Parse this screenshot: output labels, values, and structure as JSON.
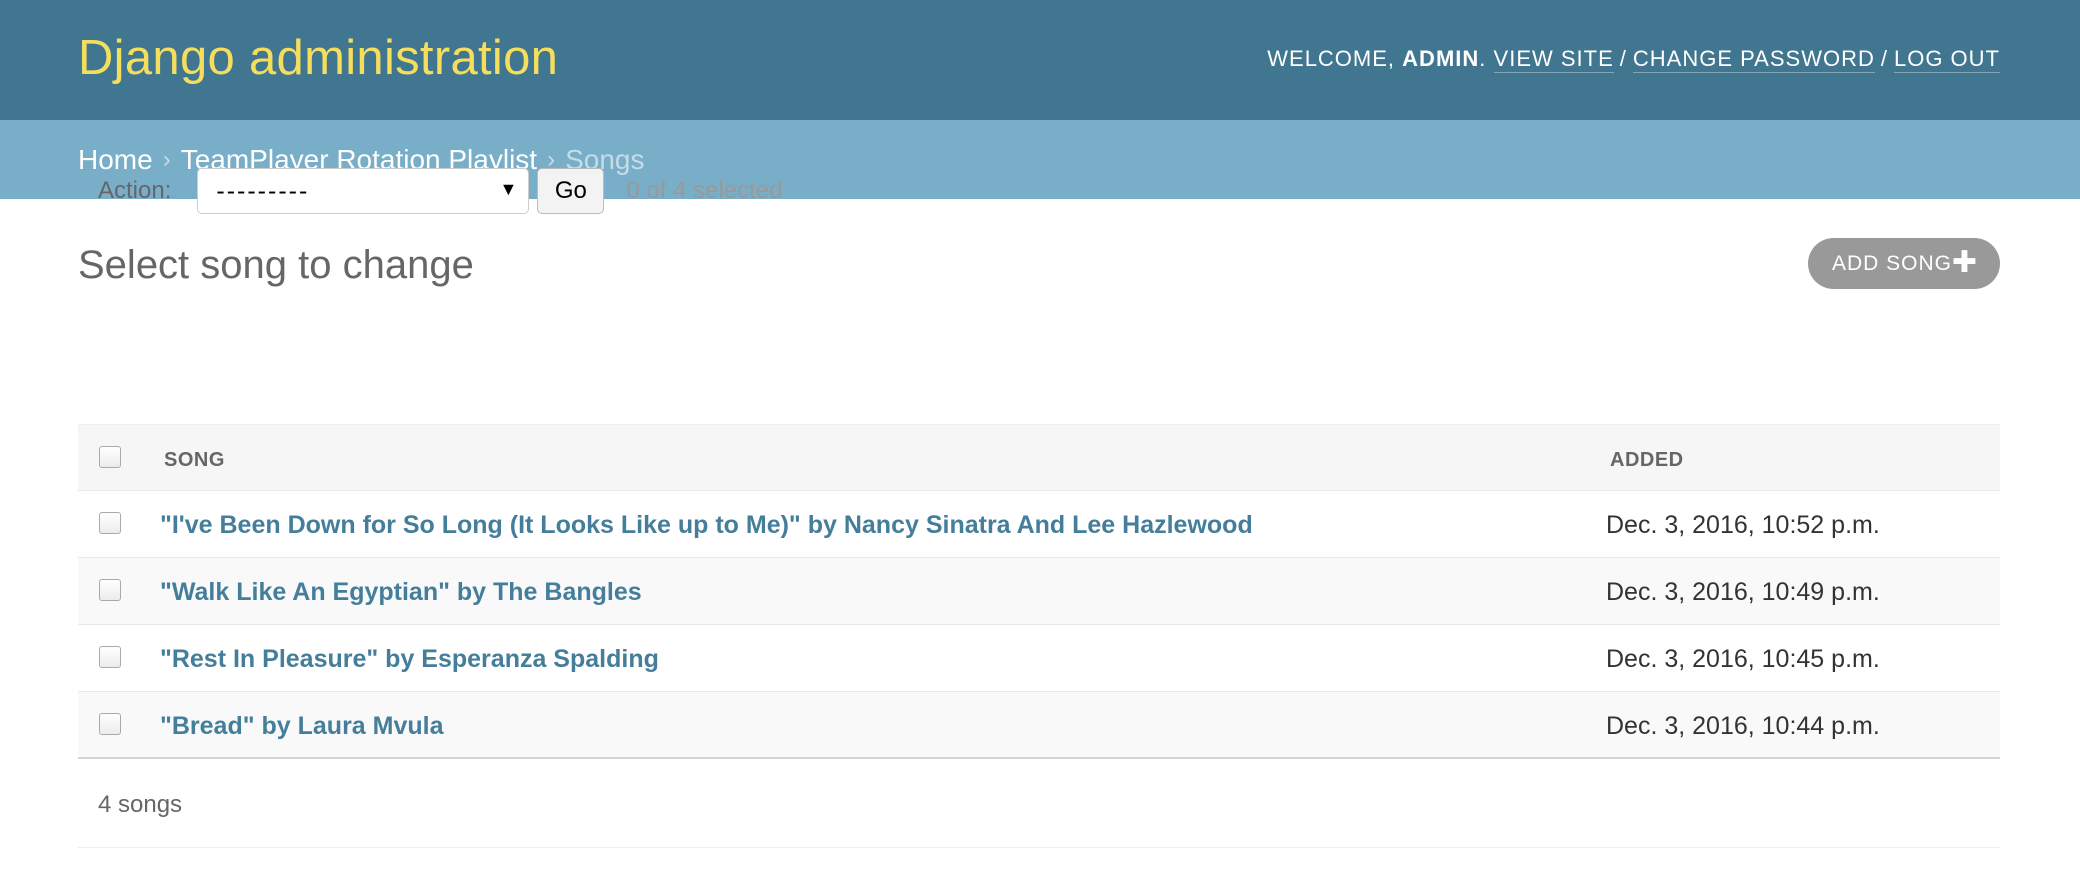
{
  "header": {
    "site_title": "Django administration",
    "welcome": "Welcome,",
    "username": "admin",
    "view_site": "View site",
    "change_password": "Change password",
    "log_out": "Log out"
  },
  "breadcrumbs": {
    "home": "Home",
    "app": "TeamPlayer Rotation Playlist",
    "current": "Songs",
    "separator": "›"
  },
  "main": {
    "title": "Select song to change",
    "add_button": "Add song"
  },
  "actions": {
    "label": "Action:",
    "selected_option": "---------",
    "go_label": "Go",
    "selected_count": "0 of 4 selected"
  },
  "table": {
    "columns": [
      "Song",
      "Added"
    ],
    "rows": [
      {
        "song": "\"I've Been Down for So Long (It Looks Like up to Me)\" by Nancy Sinatra And Lee Hazlewood",
        "added": "Dec. 3, 2016, 10:52 p.m."
      },
      {
        "song": "\"Walk Like An Egyptian\" by The Bangles",
        "added": "Dec. 3, 2016, 10:49 p.m."
      },
      {
        "song": "\"Rest In Pleasure\" by Esperanza Spalding",
        "added": "Dec. 3, 2016, 10:45 p.m."
      },
      {
        "song": "\"Bread\" by Laura Mvula",
        "added": "Dec. 3, 2016, 10:44 p.m."
      }
    ]
  },
  "paginator": {
    "count_text": "4 songs"
  },
  "colors": {
    "header_bg": "#417690",
    "breadcrumb_bg": "#79aec8",
    "title_yellow": "#f5dd5d",
    "link_blue": "#447e9b"
  }
}
